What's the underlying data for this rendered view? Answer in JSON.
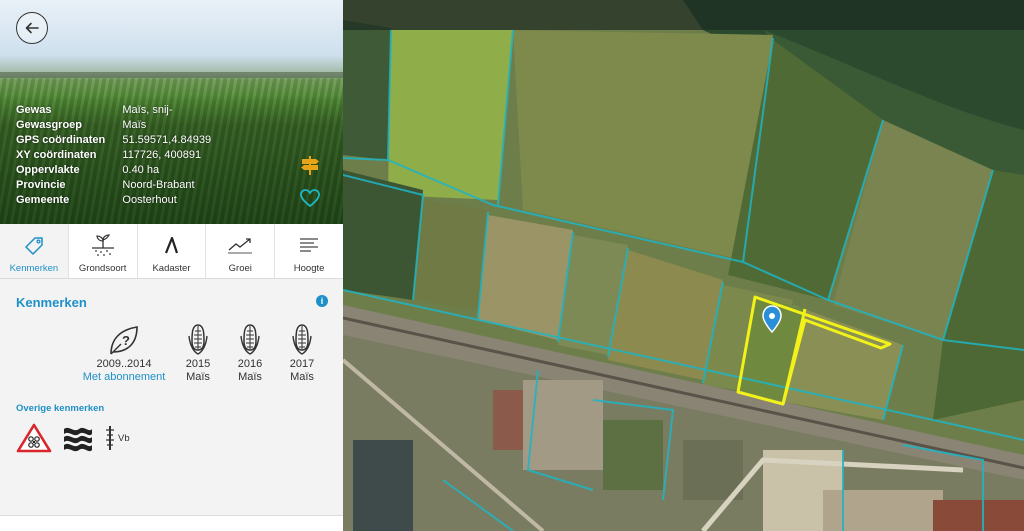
{
  "details": {
    "rows": [
      {
        "label": "Gewas",
        "value": "Maïs, snij-"
      },
      {
        "label": "Gewasgroep",
        "value": "Maïs"
      },
      {
        "label": "GPS coördinaten",
        "value": "51.59571,4.84939"
      },
      {
        "label": "XY coördinaten",
        "value": "117726, 400891"
      },
      {
        "label": "Oppervlakte",
        "value": "0.40 ha"
      },
      {
        "label": "Provincie",
        "value": "Noord-Brabant"
      },
      {
        "label": "Gemeente",
        "value": "Oosterhout"
      }
    ]
  },
  "tabs": [
    {
      "label": "Kenmerken",
      "icon": "tag-icon",
      "active": true
    },
    {
      "label": "Grondsoort",
      "icon": "soil-plant-icon",
      "active": false
    },
    {
      "label": "Kadaster",
      "icon": "cadastre-lambda-icon",
      "active": false
    },
    {
      "label": "Groei",
      "icon": "growth-chart-icon",
      "active": false
    },
    {
      "label": "Hoogte",
      "icon": "height-lines-icon",
      "active": false
    }
  ],
  "section": {
    "title": "Kenmerken",
    "history": {
      "years": "2009..2014",
      "link": "Met abonnement"
    },
    "crops": [
      {
        "year": "2015",
        "name": "Maïs"
      },
      {
        "year": "2016",
        "name": "Maïs"
      },
      {
        "year": "2017",
        "name": "Maïs"
      }
    ],
    "other_title": "Overige kenmerken",
    "other_label": "Vb"
  },
  "colors": {
    "accent": "#1e90c8",
    "selected_parcel": "#f2f21a",
    "parcel_outline": "#1fb5c4",
    "warning": "#d9262b",
    "route_icon": "#e8a317"
  }
}
